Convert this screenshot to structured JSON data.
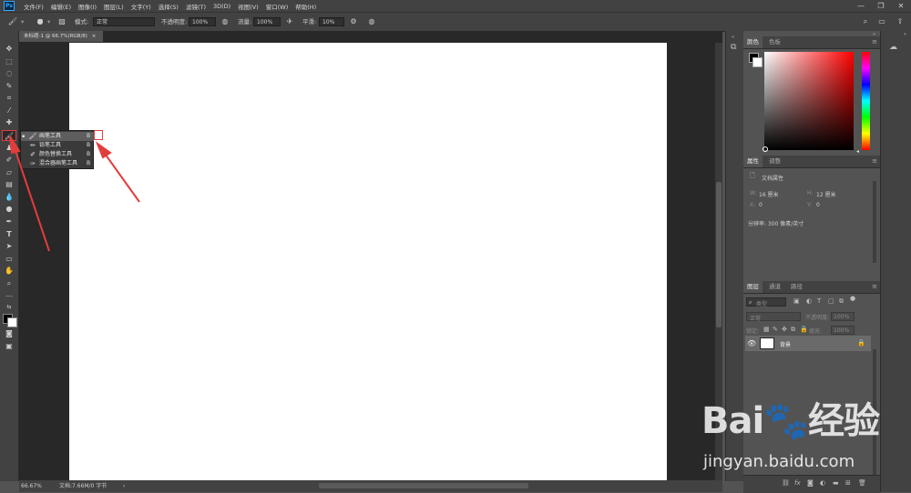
{
  "menubar": {
    "logo": "Ps",
    "items": [
      "文件(F)",
      "编辑(E)",
      "图像(I)",
      "图层(L)",
      "文字(Y)",
      "选择(S)",
      "滤镜(T)",
      "3D(D)",
      "视图(V)",
      "窗口(W)",
      "帮助(H)"
    ],
    "controls": [
      "—",
      "❐",
      "✕"
    ]
  },
  "options": {
    "brush_size": "13",
    "mode_label": "模式:",
    "mode_value": "正常",
    "opacity_label": "不透明度:",
    "opacity_value": "100%",
    "flow_label": "流量:",
    "flow_value": "100%",
    "smooth_label": "平滑:",
    "smooth_value": "10%"
  },
  "document": {
    "tab_title": "未标题-1 @ 66.7%(RGB/8)",
    "tab_close": "×",
    "canvas_color": "#ffffff"
  },
  "status": {
    "zoom": "66.67%",
    "doc_info": "文档:7.66M/0 字节",
    "arrow": "›"
  },
  "flyout": {
    "items": [
      {
        "icon": "brush-icon",
        "label": "画笔工具",
        "key": "B"
      },
      {
        "icon": "pencil-icon",
        "label": "铅笔工具",
        "key": "B"
      },
      {
        "icon": "color-replace-icon",
        "label": "颜色替换工具",
        "key": "B"
      },
      {
        "icon": "mixer-brush-icon",
        "label": "混合器画笔工具",
        "key": "B"
      }
    ]
  },
  "color_panel": {
    "tabs": [
      "颜色",
      "色板"
    ],
    "fg": "#000000",
    "bg": "#ffffff",
    "hue_color": "#ff0000"
  },
  "properties_panel": {
    "tabs": [
      "属性",
      "调整"
    ],
    "section": "文档属性",
    "w_label": "W:",
    "w_value": "16 厘米",
    "h_label": "H:",
    "h_value": "12 厘米",
    "x_label": "X:",
    "x_value": "0",
    "y_label": "Y:",
    "y_value": "0",
    "resolution": "分辨率: 300 像素/英寸"
  },
  "layers_panel": {
    "tabs": [
      "图层",
      "通道",
      "路径"
    ],
    "filter_placeholder": "类型",
    "blend_mode": "正常",
    "opacity_label": "不透明度:",
    "opacity_value": "100%",
    "lock_label": "锁定:",
    "fill_label": "填充:",
    "fill_value": "100%",
    "layers": [
      {
        "name": "背景",
        "visible": true,
        "locked": true
      }
    ]
  },
  "watermark": {
    "logo": "Bai🐾经验",
    "url": "jingyan.baidu.com"
  },
  "colors": {
    "annotation_red": "#e23d3d",
    "panel_bg": "#535353",
    "chrome_bg": "#424242"
  }
}
